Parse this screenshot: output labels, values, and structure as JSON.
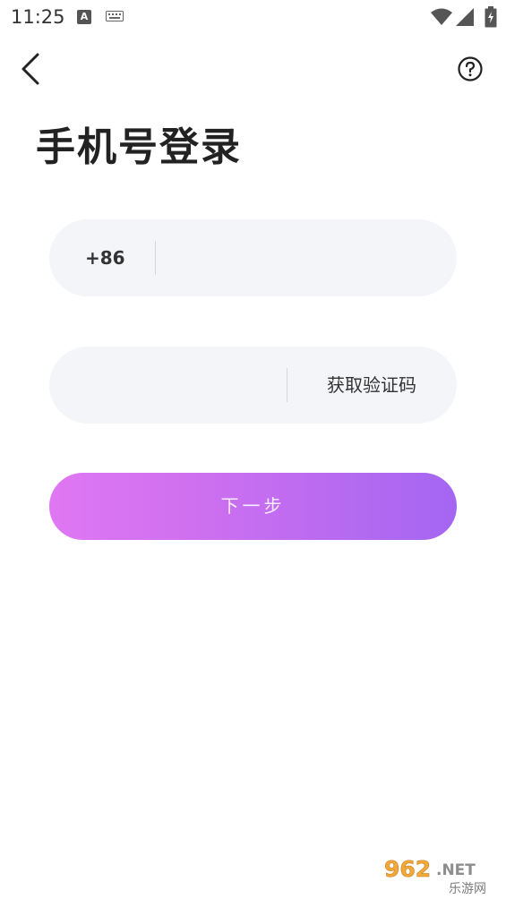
{
  "status_bar": {
    "time": "11:25",
    "a_icon_letter": "A"
  },
  "nav": {
    "back_icon": "chevron-left-icon",
    "help_icon": "help-circle-icon"
  },
  "page": {
    "title": "手机号登录"
  },
  "phone_field": {
    "country_code": "+86",
    "value": "",
    "placeholder": ""
  },
  "code_field": {
    "value": "",
    "placeholder": "",
    "get_code_label": "获取验证码"
  },
  "next_button": {
    "label": "下一步",
    "gradient_start": "#e077f2",
    "gradient_end": "#a466f1"
  },
  "watermark": {
    "text_main": "962.NET",
    "text_sub": "乐游网"
  },
  "colors": {
    "background": "#ffffff",
    "field_background": "#f4f5f8",
    "title_text": "#222222"
  }
}
